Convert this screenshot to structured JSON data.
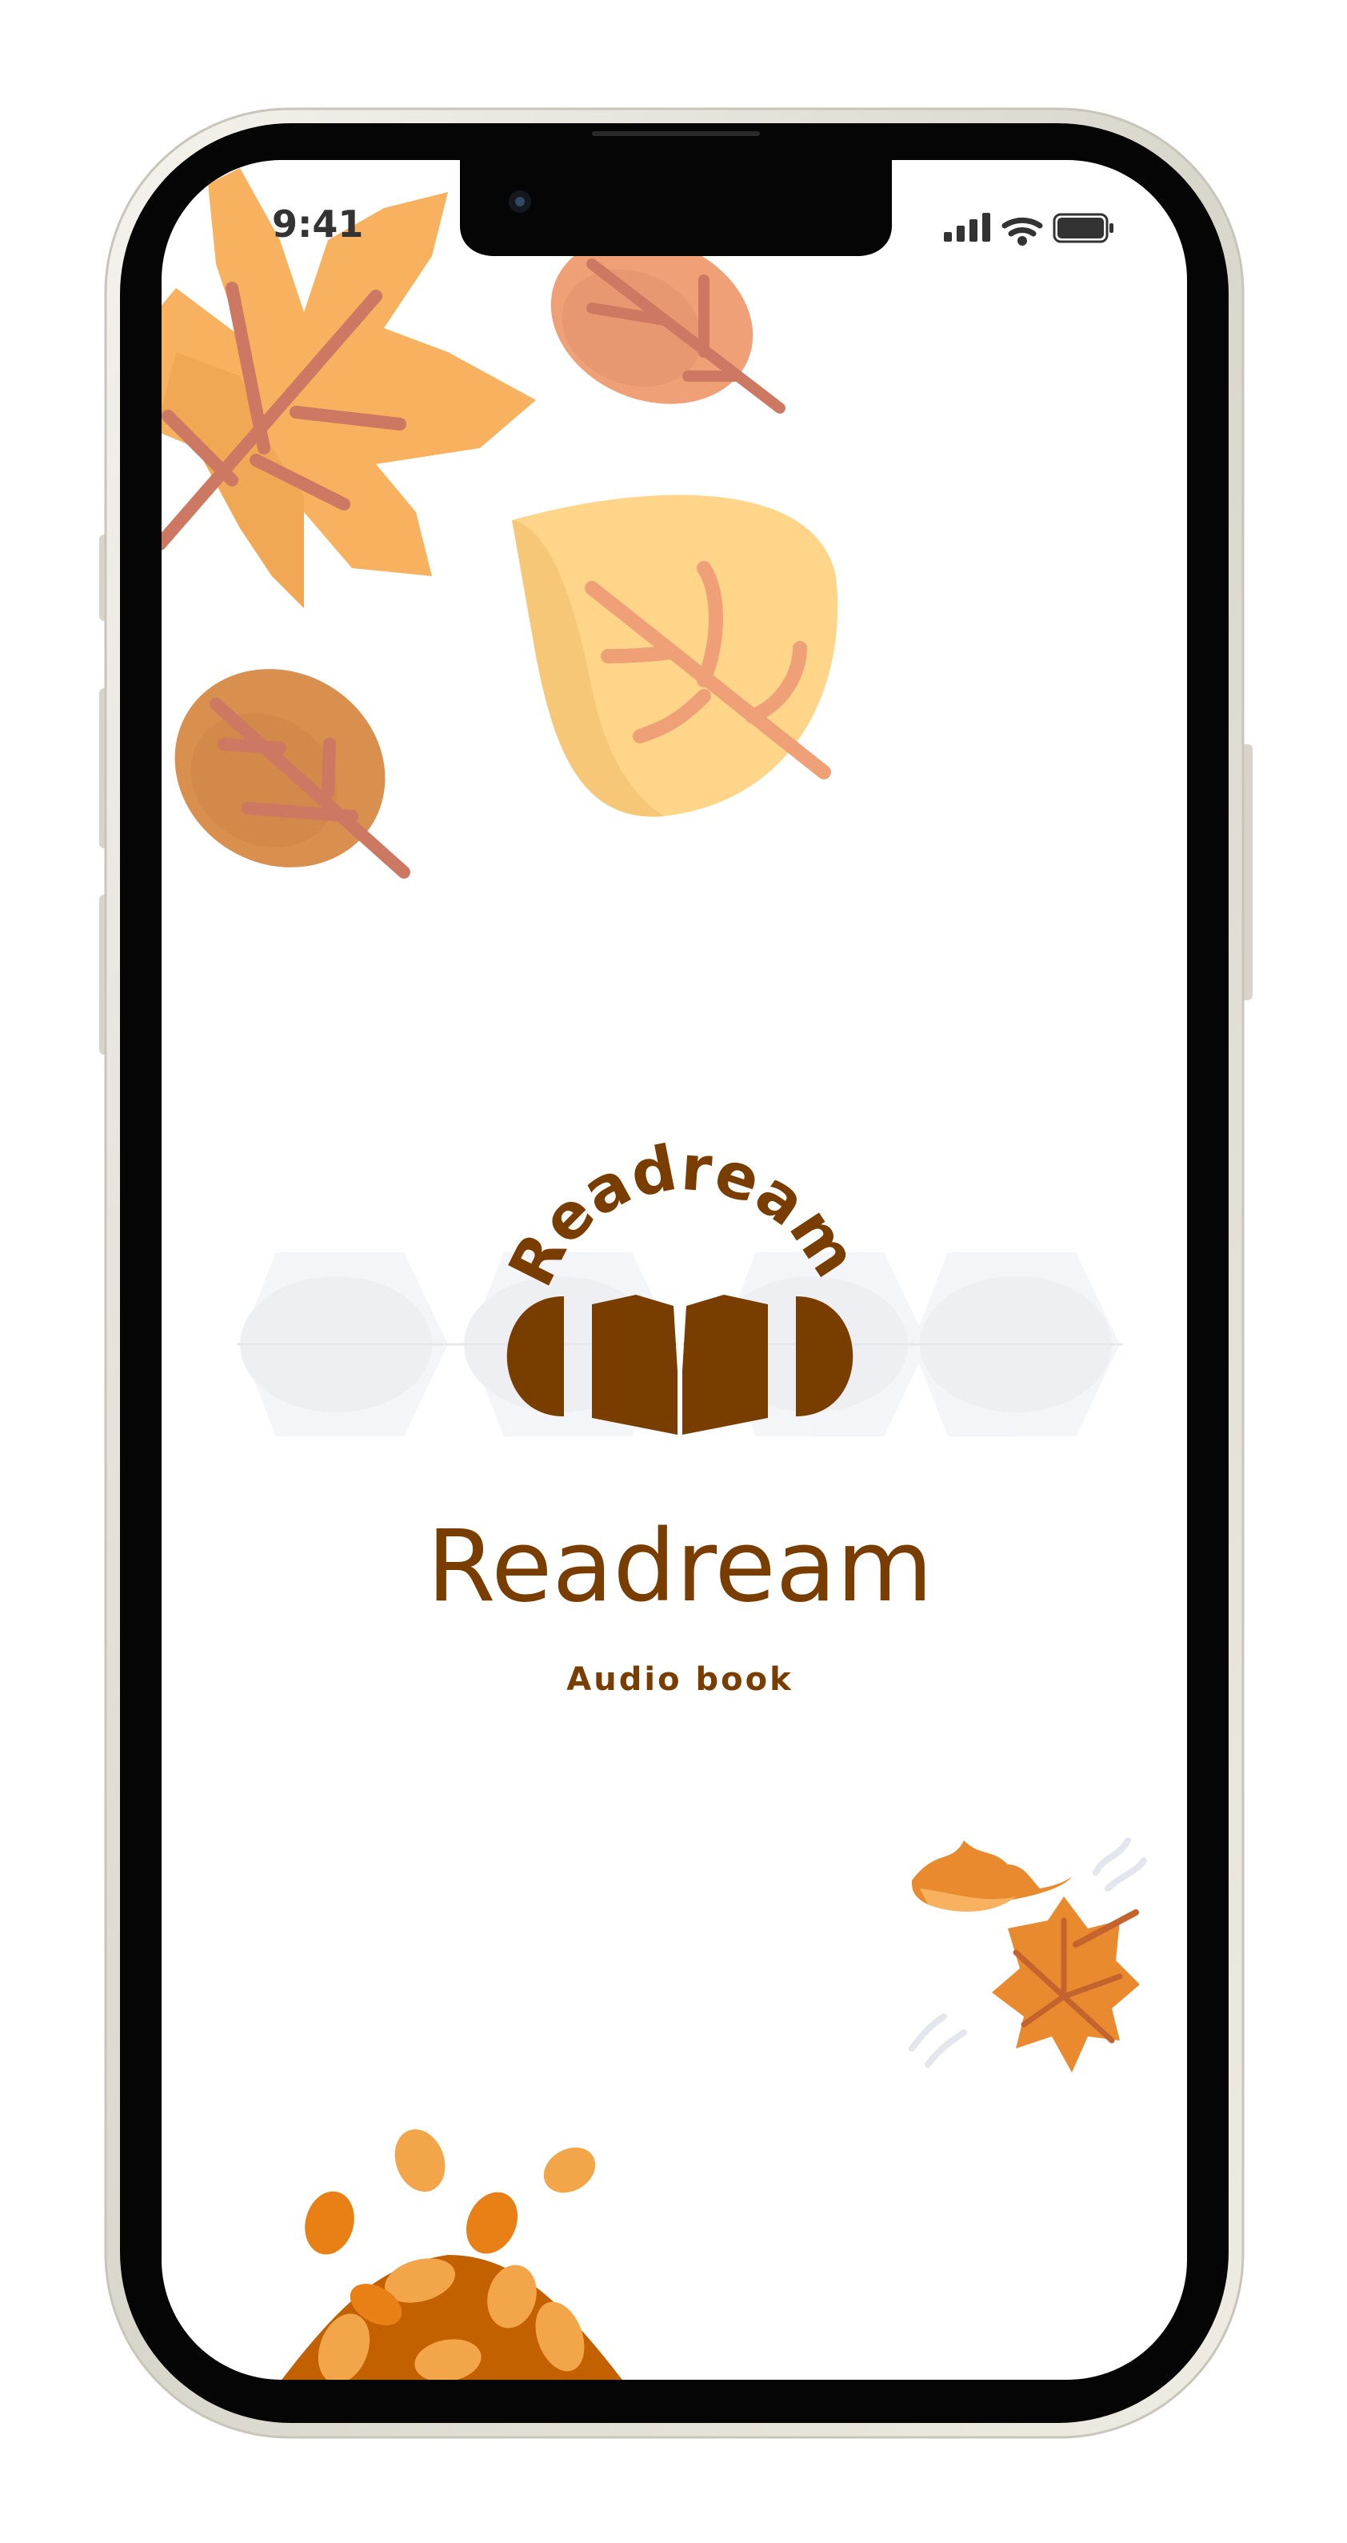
{
  "status_bar": {
    "time": "9:41"
  },
  "app": {
    "logo_arc_text": "Readream",
    "title": "Readream",
    "subtitle": "Audio book"
  },
  "colors": {
    "brand_brown": "#7A3D00",
    "leaf_orange": "#F7B15F",
    "leaf_yellow": "#FFD689",
    "leaf_rust": "#EFA077",
    "leaf_dark": "#D9904E",
    "vein": "#CD7862",
    "pile_orange": "#C36000",
    "frame_silver": "#E4E1D8",
    "bezel_black": "#050505"
  },
  "icons": {
    "status_right": [
      "signal-icon",
      "wifi-icon",
      "battery-icon"
    ],
    "logo": "headphones-book-icon"
  }
}
